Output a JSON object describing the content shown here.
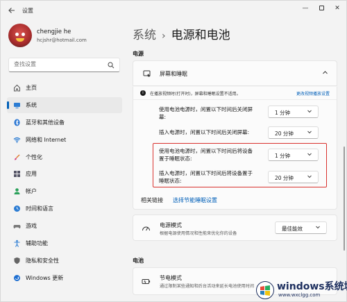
{
  "window": {
    "title": "设置"
  },
  "profile": {
    "name": "chengjie he",
    "email": "hcjshr@hotmail.com"
  },
  "search": {
    "placeholder": "查找设置"
  },
  "sidebar": {
    "items": [
      {
        "label": "主页",
        "icon": "home-icon",
        "active": false
      },
      {
        "label": "系统",
        "icon": "monitor-icon",
        "active": true
      },
      {
        "label": "蓝牙和其他设备",
        "icon": "bluetooth-icon",
        "active": false
      },
      {
        "label": "网络和 Internet",
        "icon": "wifi-icon",
        "active": false
      },
      {
        "label": "个性化",
        "icon": "brush-icon",
        "active": false
      },
      {
        "label": "应用",
        "icon": "apps-icon",
        "active": false
      },
      {
        "label": "帐户",
        "icon": "person-icon",
        "active": false
      },
      {
        "label": "时间和语言",
        "icon": "globe-clock-icon",
        "active": false
      },
      {
        "label": "游戏",
        "icon": "gamepad-icon",
        "active": false
      },
      {
        "label": "辅助功能",
        "icon": "accessibility-icon",
        "active": false
      },
      {
        "label": "隐私和安全性",
        "icon": "shield-icon",
        "active": false
      },
      {
        "label": "Windows 更新",
        "icon": "update-icon",
        "active": false
      }
    ]
  },
  "breadcrumb": {
    "parent": "系统",
    "separator": "›",
    "current": "电源和电池"
  },
  "power_section": {
    "label": "电源",
    "screen_sleep": {
      "title": "屏幕和睡眠",
      "info_text": "在播放视频时(打开时)，屏幕和睡眠设置不适用。",
      "info_link": "更改视频播放设置",
      "rows": [
        {
          "label": "使用电池电源时，闲置以下时间后关闭屏幕:",
          "value": "1 分钟"
        },
        {
          "label": "插入电源时，闲置以下时间后关闭屏幕:",
          "value": "20 分钟"
        },
        {
          "label": "使用电池电源时，闲置以下时间后将设备置于睡眠状态:",
          "value": "1 分钟"
        },
        {
          "label": "插入电源时，闲置以下时间后将设备置于睡眠状态:",
          "value": "20 分钟"
        }
      ]
    },
    "related": {
      "label": "相关链接",
      "link": "选择节能睡眠设置"
    },
    "power_mode": {
      "title": "电源模式",
      "subtitle": "根据电源使用情况和性能来优化你的设备",
      "value": "最佳能效"
    }
  },
  "battery_section": {
    "label": "电池",
    "saver": {
      "title": "节电模式",
      "subtitle": "通过限制某些通知和后台活动来延长电池使用时间"
    }
  },
  "watermark": {
    "brand": "windows系统城",
    "url": "www.wxclgg.com"
  },
  "colors": {
    "accent": "#005fb8",
    "highlight": "#d9302c",
    "background": "#f3f3f3",
    "card": "#fbfbfb"
  }
}
